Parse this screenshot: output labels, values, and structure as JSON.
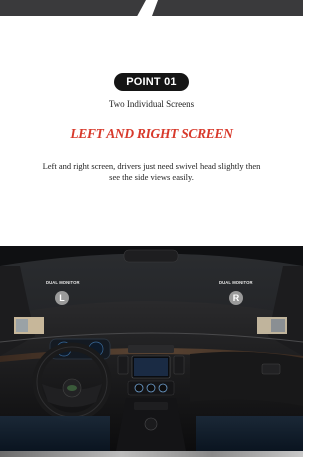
{
  "section": {
    "badge": "POINT 01",
    "subtitle": "Two Individual Screens",
    "headline": "LEFT AND RIGHT SCREEN",
    "description": "Left and right screen, drivers just need swivel head slightly then see the side views easily."
  },
  "photo": {
    "left_monitor_label": "DUAL MONITOR",
    "right_monitor_label": "DUAL MONITOR",
    "left_marker": "L",
    "right_marker": "R"
  },
  "colors": {
    "badge_bg": "#151515",
    "headline": "#d8392b",
    "band": "#3a3a3c"
  }
}
